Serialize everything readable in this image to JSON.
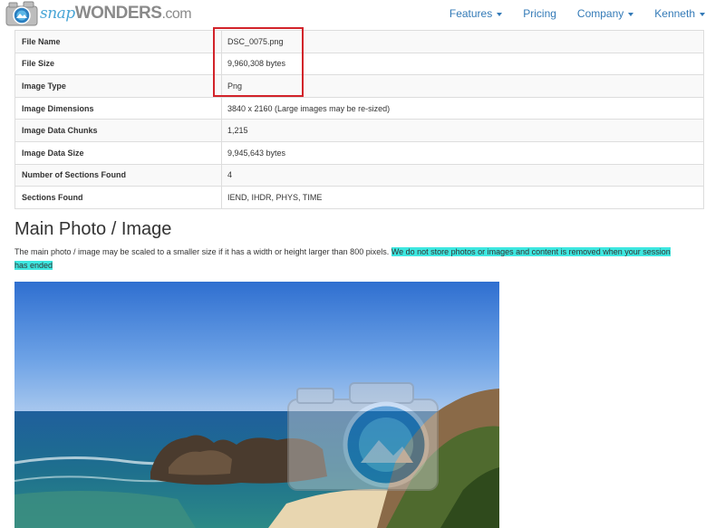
{
  "brand": {
    "snap": "snap",
    "wonders": "WONDERS",
    "dotcom": ".com",
    "logo_icon": "camera-icon"
  },
  "nav": {
    "items": [
      {
        "label": "Features",
        "dropdown": true
      },
      {
        "label": "Pricing",
        "dropdown": false
      },
      {
        "label": "Company",
        "dropdown": true
      },
      {
        "label": "Kenneth",
        "dropdown": true
      }
    ]
  },
  "file_info": {
    "rows": [
      {
        "key": "File Name",
        "value": "DSC_0075.png"
      },
      {
        "key": "File Size",
        "value": "9,960,308 bytes"
      },
      {
        "key": "Image Type",
        "value": "Png"
      },
      {
        "key": "Image Dimensions",
        "value": "3840 x 2160 (Large images may be re-sized)"
      },
      {
        "key": "Image Data Chunks",
        "value": "1,215"
      },
      {
        "key": "Image Data Size",
        "value": "9,945,643 bytes"
      },
      {
        "key": "Number of Sections Found",
        "value": "4"
      },
      {
        "key": "Sections Found",
        "value": "IEND, IHDR, PHYS, TIME"
      }
    ]
  },
  "main_photo": {
    "title": "Main Photo / Image",
    "description": "The main photo / image may be scaled to a smaller size if it has a width or height larger than 800 pixels.",
    "notice": "We do not store photos or images and content is removed when your session has ended"
  },
  "colors": {
    "link": "#337ab7",
    "highlight": "#3de7e0",
    "annotation_box": "#d2232a",
    "logo_blue": "#4aa6d6"
  }
}
